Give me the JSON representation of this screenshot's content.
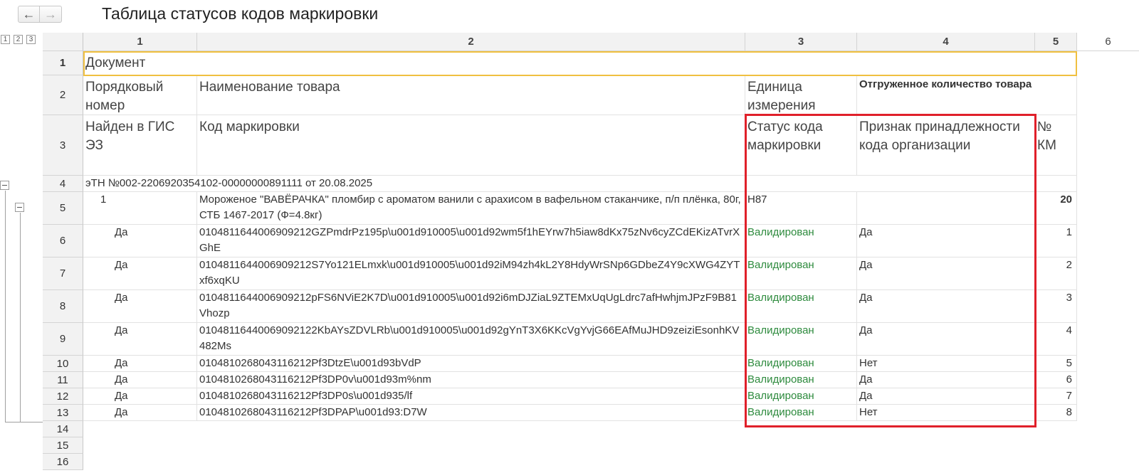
{
  "nav": {
    "back_icon": "←",
    "forward_icon": "→"
  },
  "title": "Таблица статусов кодов маркировки",
  "grouping_levels": [
    "1",
    "2",
    "3"
  ],
  "column_numbers": [
    "1",
    "2",
    "3",
    "4",
    "5",
    "6"
  ],
  "row_numbers": [
    "1",
    "2",
    "3",
    "4",
    "5",
    "6",
    "7",
    "8",
    "9",
    "10",
    "11",
    "12",
    "13",
    "14",
    "15",
    "16"
  ],
  "header": {
    "document": "Документ",
    "order_number": "Порядковый номер",
    "product_name": "Наименование товара",
    "unit": "Единица измерения",
    "shipped_qty": "Отгруженное количество товара",
    "found_in_gis": "Найден в ГИС ЭЗ",
    "marking_code": "Код маркировки",
    "code_status": "Статус кода маркировки",
    "org_sign": "Признак принадлежности кода организации",
    "km_number": "№ КМ"
  },
  "document_row": "эТН №002-2206920354102-00000000891111 от 20.08.2025",
  "product": {
    "number": "1",
    "name": "Мороженое \"ВАВЁРАЧКА\" пломбир с ароматом ванили с арахисом в вафельном стаканчике, п/п плёнка, 80г, СТБ 1467-2017 (Ф=4.8кг)",
    "unit": "Н87",
    "qty": "20"
  },
  "codes": [
    {
      "found": "Да",
      "code": "010481164400690921​2GZPmdrPz195p\\u001d910005\\u001d92wm5f1hEYrw7h5iaw8dKx75zNv6cyZCdEKizATvrXGhE",
      "status": "Валидирован",
      "org": "Да",
      "km": "1"
    },
    {
      "found": "Да",
      "code": "010481164400690921​2S7Yo121ELmxk\\u001d910005\\u001d92iM94zh4kL2Y8HdyWrSNp6GDbeZ4Y9cXWG4ZYTxf6xqKU",
      "status": "Валидирован",
      "org": "Да",
      "km": "2"
    },
    {
      "found": "Да",
      "code": "010481164400690921​2pFS6NViE2K7D\\u001d910005\\u001d92i6mDJZiaL9ZTEMxUqUgLdrc7afHwhjmJPzF9B81Vhozp",
      "status": "Валидирован",
      "org": "Да",
      "km": "3"
    },
    {
      "found": "Да",
      "code": "010481164400690921​22KbAYsZDVLRb\\u001d910005\\u001d92gYnT3X6KKcVgYvjG66EAfMuJHD9zeiziEsonhKV482Ms",
      "status": "Валидирован",
      "org": "Да",
      "km": "4"
    },
    {
      "found": "Да",
      "code": "010481026804311621​2Pf3DtzE\\u001d93bVdP",
      "status": "Валидирован",
      "org": "Нет",
      "km": "5"
    },
    {
      "found": "Да",
      "code": "010481026804311621​2Pf3DP0v\\u001d93m%nm",
      "status": "Валидирован",
      "org": "Да",
      "km": "6"
    },
    {
      "found": "Да",
      "code": "010481026804311621​2Pf3DP0s\\u001d935/lf",
      "status": "Валидирован",
      "org": "Да",
      "km": "7"
    },
    {
      "found": "Да",
      "code": "010481026804311621​2Pf3DPAP\\u001d93:D7W",
      "status": "Валидирован",
      "org": "Нет",
      "km": "8"
    }
  ],
  "colors": {
    "highlight_red": "#e0202a",
    "selection_yellow": "#f0c040",
    "status_green": "#2e8b3e"
  }
}
